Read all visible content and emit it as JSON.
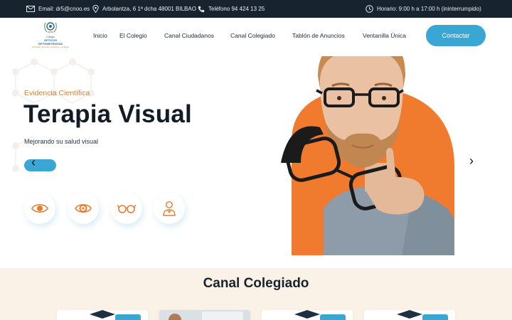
{
  "topbar": {
    "email": "Email: dr5@cnoo.es",
    "address": "Arbolantza, 6 1ª dcha 48001 BILBAO",
    "phone": "Teléfono 94 424 13 25",
    "hours": "Horario: 9:00 h a 17:00 h (ininterrumpido)"
  },
  "logo": {
    "line1": "Colegio",
    "line2": "ÓPTICOS",
    "line3": "OPTOMETRISTAS",
    "line4": "Euskadi • Asturias • Navarra • La Rioja"
  },
  "nav": {
    "items": [
      "Inicio",
      "El Colegio",
      "Canal Ciudadanos",
      "Canal Colegiado",
      "Tablón de Anuncios",
      "Ventanilla Única"
    ],
    "cta": "Contactar"
  },
  "hero": {
    "eyebrow": "Evidencia Científica",
    "title": "Terapia Visual",
    "subtitle": "Mejorando su salud visual",
    "prev_arrow": "‹",
    "next_arrow": "›",
    "features": [
      "eye-icon",
      "eye-icon",
      "glasses-icon",
      "doctor-icon"
    ]
  },
  "section": {
    "title": "Canal Colegiado"
  },
  "colors": {
    "accent_blue": "#3aa6d4",
    "accent_orange": "#e57b2b",
    "topbar_bg": "#17242f",
    "section_bg": "#fbf2e7"
  }
}
